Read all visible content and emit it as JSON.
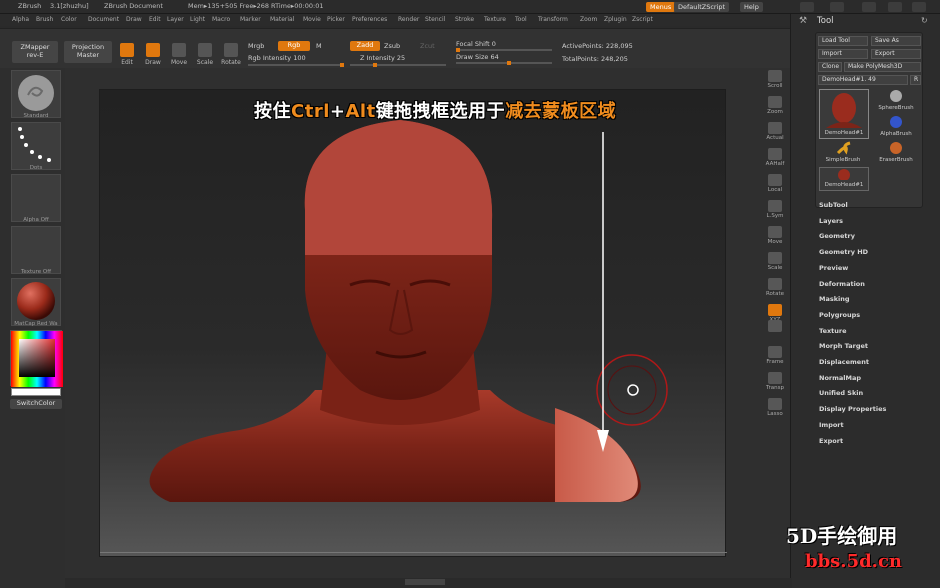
{
  "titlebar": {
    "app": "ZBrush",
    "version": "3.1[zhuzhu]",
    "document": "ZBrush Document",
    "mem": "Mem▸135+505 Free▸268 RTime▸00:00:01",
    "menus_btn": "Menus",
    "script_btn": "DefaultZScript",
    "help_btn": "Help"
  },
  "menubar": [
    "Alpha",
    "Brush",
    "Color",
    "Document",
    "Draw",
    "Edit",
    "Layer",
    "Light",
    "Macro",
    "Marker",
    "Material",
    "Movie",
    "Picker",
    "Preferences",
    "Render",
    "Stencil",
    "Stroke",
    "Texture",
    "Tool",
    "Transform",
    "Zoom",
    "Zplugin",
    "Zscript"
  ],
  "shelf": {
    "zmapper": "ZMapper",
    "zmapper_sub": "rev-E",
    "projection": "Projection",
    "projection_sub": "Master",
    "edit": "Edit",
    "draw": "Draw",
    "move": "Move",
    "scale": "Scale",
    "rotate": "Rotate",
    "mrgb": "Mrgb",
    "rgb": "Rgb",
    "m": "M",
    "rgb_intensity": "Rgb Intensity 100",
    "zadd": "Zadd",
    "zsub": "Zsub",
    "zcut": "Zcut",
    "z_intensity": "Z Intensity 25",
    "focal_shift": "Focal Shift 0",
    "draw_size": "Draw Size 64",
    "active_points": "ActivePoints: 228,095",
    "total_points": "TotalPoints: 248,205",
    "rgb_intensity_level": 1.0,
    "z_intensity_level": 0.25,
    "focal_shift_level": 0.0,
    "draw_size_level": 0.55
  },
  "leftpanel": {
    "brush": "Standard",
    "stroke": "Dots",
    "alpha": "Alpha Off",
    "texture": "Texture Off",
    "material": "MatCap Red Wa",
    "switchcolor": "SwitchColor"
  },
  "banner": {
    "part1": "按住",
    "part2": "Ctrl",
    "part3": "+",
    "part4": "Alt",
    "part5": "键拖拽框选用于",
    "part6": "减去蒙板区域"
  },
  "rightshelf": [
    "Scroll",
    "Zoom",
    "Actual",
    "AAHalf",
    "Local",
    "L.Sym",
    "Move",
    "Scale",
    "Rotate",
    "XYZ",
    "",
    "Frame",
    "Transp",
    "Lasso"
  ],
  "toolpanel": {
    "title": "Tool",
    "load_tool": "Load Tool",
    "save_as": "Save As",
    "import": "Import",
    "export": "Export",
    "clone": "Clone",
    "make_polymesh": "Make PolyMesh3D",
    "current_tool": "DemoHead#1. 49",
    "r": "R",
    "thumbs": [
      "DemoHead#1",
      "SphereBrush",
      "AlphaBrush",
      "SimpleBrush",
      "EraserBrush",
      "DemoHead#1"
    ],
    "menu": [
      "SubTool",
      "Layers",
      "Geometry",
      "Geometry HD",
      "Preview",
      "Deformation",
      "Masking",
      "Polygroups",
      "Texture",
      "Morph Target",
      "Displacement",
      "NormalMap",
      "Unified Skin",
      "Display Properties",
      "Import",
      "Export"
    ]
  },
  "watermark": {
    "line1": "5D手绘御用",
    "line2": "bbs.5d.cn"
  }
}
